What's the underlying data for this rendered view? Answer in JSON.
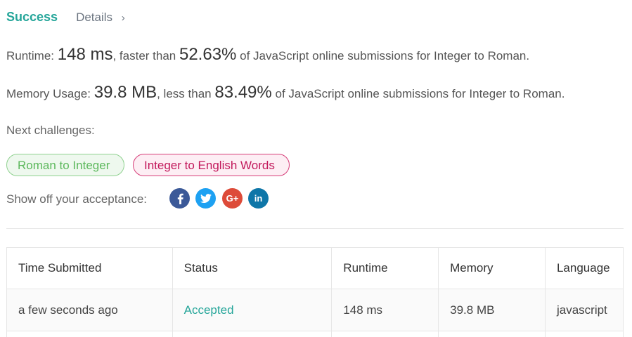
{
  "header": {
    "status": "Success",
    "details_label": "Details",
    "chevron": "›"
  },
  "runtime": {
    "label": "Runtime:",
    "value": "148 ms",
    "comparison": ", faster than",
    "percent": "52.63%",
    "suffix": "of JavaScript online submissions for Integer to Roman."
  },
  "memory": {
    "label": "Memory Usage:",
    "value": "39.8 MB",
    "comparison": ", less than",
    "percent": "83.49%",
    "suffix": "of JavaScript online submissions for Integer to Roman."
  },
  "next": {
    "label": "Next challenges:",
    "items": [
      {
        "label": "Roman to Integer",
        "difficulty_color": "#5cb85c"
      },
      {
        "label": "Integer to English Words",
        "difficulty_color": "#c2185b"
      }
    ]
  },
  "share": {
    "label": "Show off your acceptance:",
    "icons": [
      {
        "name": "facebook-icon",
        "glyph": "f",
        "color": "#3b5998"
      },
      {
        "name": "twitter-icon",
        "glyph": "t",
        "color": "#1da1f2"
      },
      {
        "name": "google-plus-icon",
        "glyph": "G+",
        "color": "#dd4b39"
      },
      {
        "name": "linkedin-icon",
        "glyph": "in",
        "color": "#0e76a8"
      }
    ]
  },
  "table": {
    "headers": [
      "Time Submitted",
      "Status",
      "Runtime",
      "Memory",
      "Language"
    ],
    "rows": [
      [
        "a few seconds ago",
        "Accepted",
        "148 ms",
        "39.8 MB",
        "javascript"
      ]
    ]
  },
  "colors": {
    "success": "#26a69a",
    "accepted": "#26a69a"
  }
}
